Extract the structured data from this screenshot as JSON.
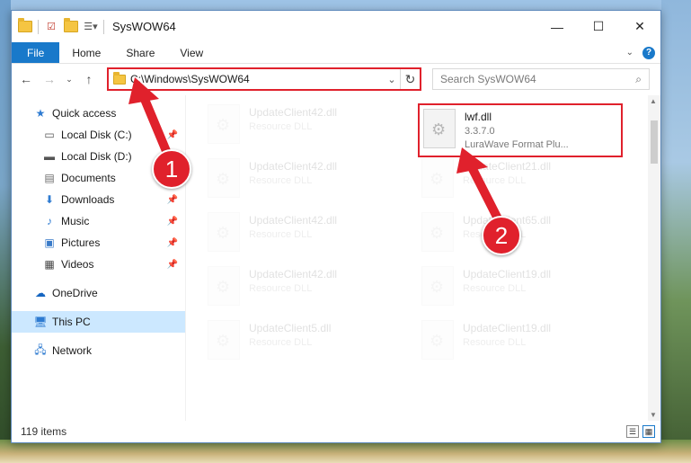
{
  "window": {
    "title": "SysWOW64",
    "controls": {
      "minimize": "—",
      "maximize": "☐",
      "close": "✕"
    }
  },
  "ribbon": {
    "tabs": [
      "File",
      "Home",
      "Share",
      "View"
    ]
  },
  "navigation": {
    "address": "C:\\Windows\\SysWOW64",
    "search_placeholder": "Search SysWOW64"
  },
  "sidebar": {
    "quick_access": "Quick access",
    "items": [
      {
        "label": "Local Disk (C:)",
        "pinned": true
      },
      {
        "label": "Local Disk (D:)",
        "pinned": false
      },
      {
        "label": "Documents",
        "pinned": true
      },
      {
        "label": "Downloads",
        "pinned": true
      },
      {
        "label": "Music",
        "pinned": true
      },
      {
        "label": "Pictures",
        "pinned": true
      },
      {
        "label": "Videos",
        "pinned": true
      }
    ],
    "onedrive": "OneDrive",
    "this_pc": "This PC",
    "network": "Network"
  },
  "files": {
    "left_column": [
      {
        "name": "UpdateClient42.dll",
        "type": "Resource DLL"
      },
      {
        "name": "UpdateClient42.dll",
        "type": "Resource DLL"
      },
      {
        "name": "UpdateClient42.dll",
        "type": "Resource DLL"
      },
      {
        "name": "UpdateClient42.dll",
        "type": "Resource DLL"
      },
      {
        "name": "UpdateClient5.dll",
        "type": "Resource DLL"
      }
    ],
    "right_column": [
      {
        "name": "lwf.dll",
        "version": "3.3.7.0",
        "description": "LuraWave Format Plu..."
      },
      {
        "name": "UpdateClient21.dll",
        "type": "Resource DLL"
      },
      {
        "name": "UpdateClient65.dll",
        "type": "Resource DLL"
      },
      {
        "name": "UpdateClient19.dll",
        "type": "Resource DLL"
      },
      {
        "name": "UpdateClient19.dll",
        "type": "Resource DLL"
      }
    ]
  },
  "status": {
    "item_count": "119 items"
  },
  "annotations": {
    "step1": "1",
    "step2": "2"
  },
  "colors": {
    "accent": "#1979ca",
    "highlight": "#e0212c",
    "selected": "#cce8ff"
  }
}
